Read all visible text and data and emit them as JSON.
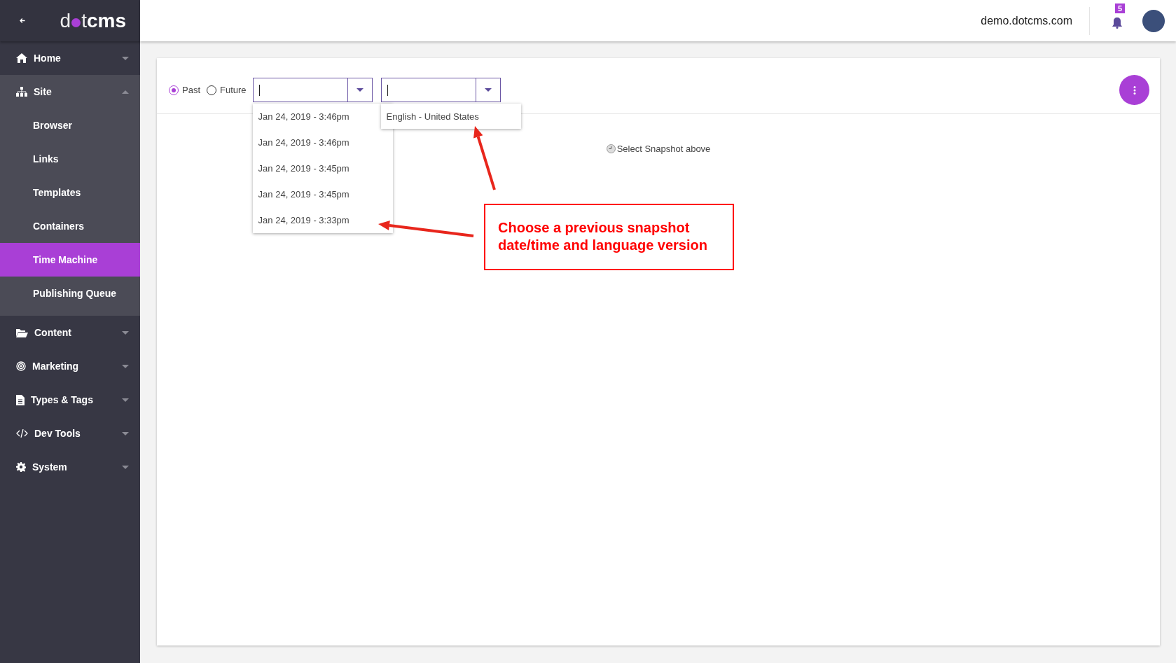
{
  "logo": {
    "parts": [
      "d",
      "t",
      "cms"
    ]
  },
  "sidebar": {
    "items": [
      {
        "label": "Home",
        "expanded": false
      },
      {
        "label": "Site",
        "expanded": true,
        "children": [
          {
            "label": "Browser",
            "selected": false
          },
          {
            "label": "Links",
            "selected": false
          },
          {
            "label": "Templates",
            "selected": false
          },
          {
            "label": "Containers",
            "selected": false
          },
          {
            "label": "Time Machine",
            "selected": true
          },
          {
            "label": "Publishing Queue",
            "selected": false
          }
        ]
      },
      {
        "label": "Content",
        "expanded": false
      },
      {
        "label": "Marketing",
        "expanded": false
      },
      {
        "label": "Types & Tags",
        "expanded": false
      },
      {
        "label": "Dev Tools",
        "expanded": false
      },
      {
        "label": "System",
        "expanded": false
      }
    ]
  },
  "header": {
    "site": "demo.dotcms.com",
    "notifications": "5"
  },
  "toolbar": {
    "radios": [
      {
        "label": "Past",
        "selected": true
      },
      {
        "label": "Future",
        "selected": false
      }
    ],
    "date_field": {
      "focused": true,
      "expanded": true,
      "options": [
        "Jan 24, 2019 - 3:46pm",
        "Jan 24, 2019 - 3:46pm",
        "Jan 24, 2019 - 3:45pm",
        "Jan 24, 2019 - 3:45pm",
        "Jan 24, 2019 - 3:33pm"
      ]
    },
    "language_field": {
      "focused": true,
      "expanded": true,
      "options": [
        "English - United States"
      ]
    }
  },
  "empty_state": "Select Snapshot above",
  "annotation": {
    "lines": [
      "Choose a previous snapshot",
      "date/time and language version"
    ]
  }
}
